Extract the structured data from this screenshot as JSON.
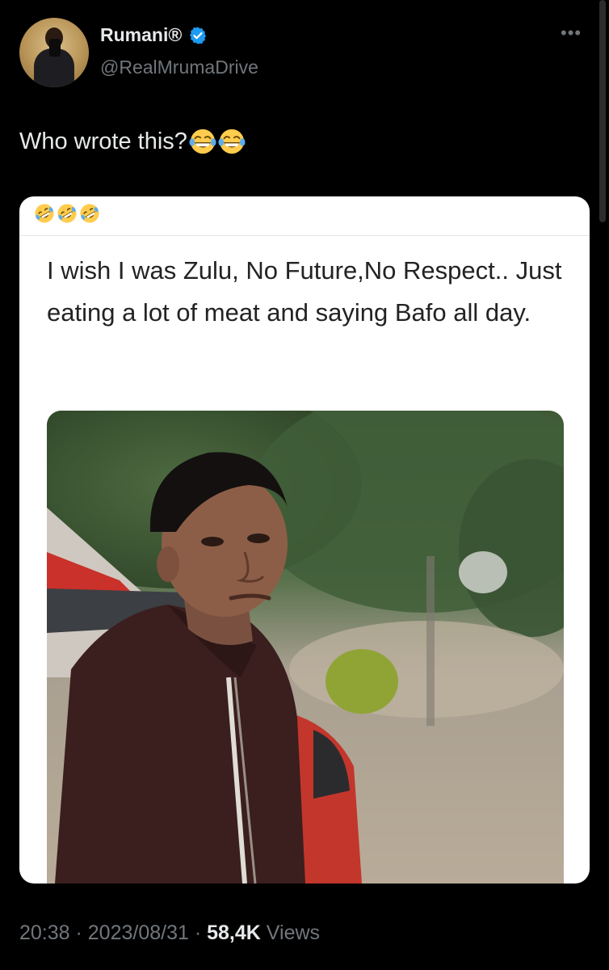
{
  "author": {
    "display_name": "Rumani®",
    "handle": "@RealMrumaDrive",
    "verified": true
  },
  "tweet": {
    "text": "Who wrote this?",
    "emojis": [
      "laughing-tears-emoji",
      "laughing-tears-emoji"
    ]
  },
  "quoted_image": {
    "header_emojis": [
      "rofl-emoji",
      "rofl-emoji",
      "rofl-emoji"
    ],
    "text": "I wish I was Zulu, No Future,No Respect.. Just eating a lot of meat and saying Bafo all day.",
    "photo_subject": "person-photo"
  },
  "meta": {
    "time": "20:38",
    "separator": " · ",
    "date": "2023/08/31",
    "views_count": "58,4K",
    "views_label": " Views"
  },
  "icons": {
    "more": "more-icon",
    "verified": "verified-badge-icon"
  },
  "colors": {
    "background": "#000000",
    "text_primary": "#e7e9ea",
    "text_secondary": "#71767b",
    "verified_blue": "#1d9bf0"
  }
}
